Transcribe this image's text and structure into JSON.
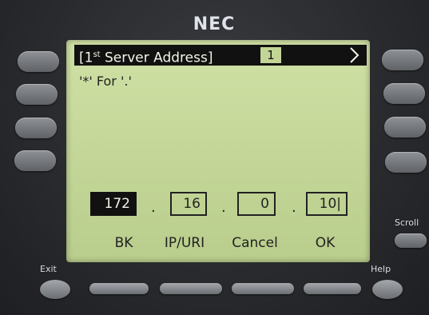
{
  "brand": "NEC",
  "screen": {
    "title_prefix": "[1",
    "title_sup": "st",
    "title_suffix": " Server Address]",
    "line_number": "1",
    "hint": "'*' For '.'",
    "ip_octets": [
      "172",
      "16",
      "0",
      "10|"
    ],
    "active_octet": 0,
    "separator": "."
  },
  "softkeys": [
    "BK",
    "IP/URI",
    "Cancel",
    "OK"
  ],
  "hardware_labels": {
    "exit": "Exit",
    "help": "Help",
    "scroll": "Scroll"
  },
  "icons": {
    "scroll_indicator": "chevron-up-down-icon"
  }
}
